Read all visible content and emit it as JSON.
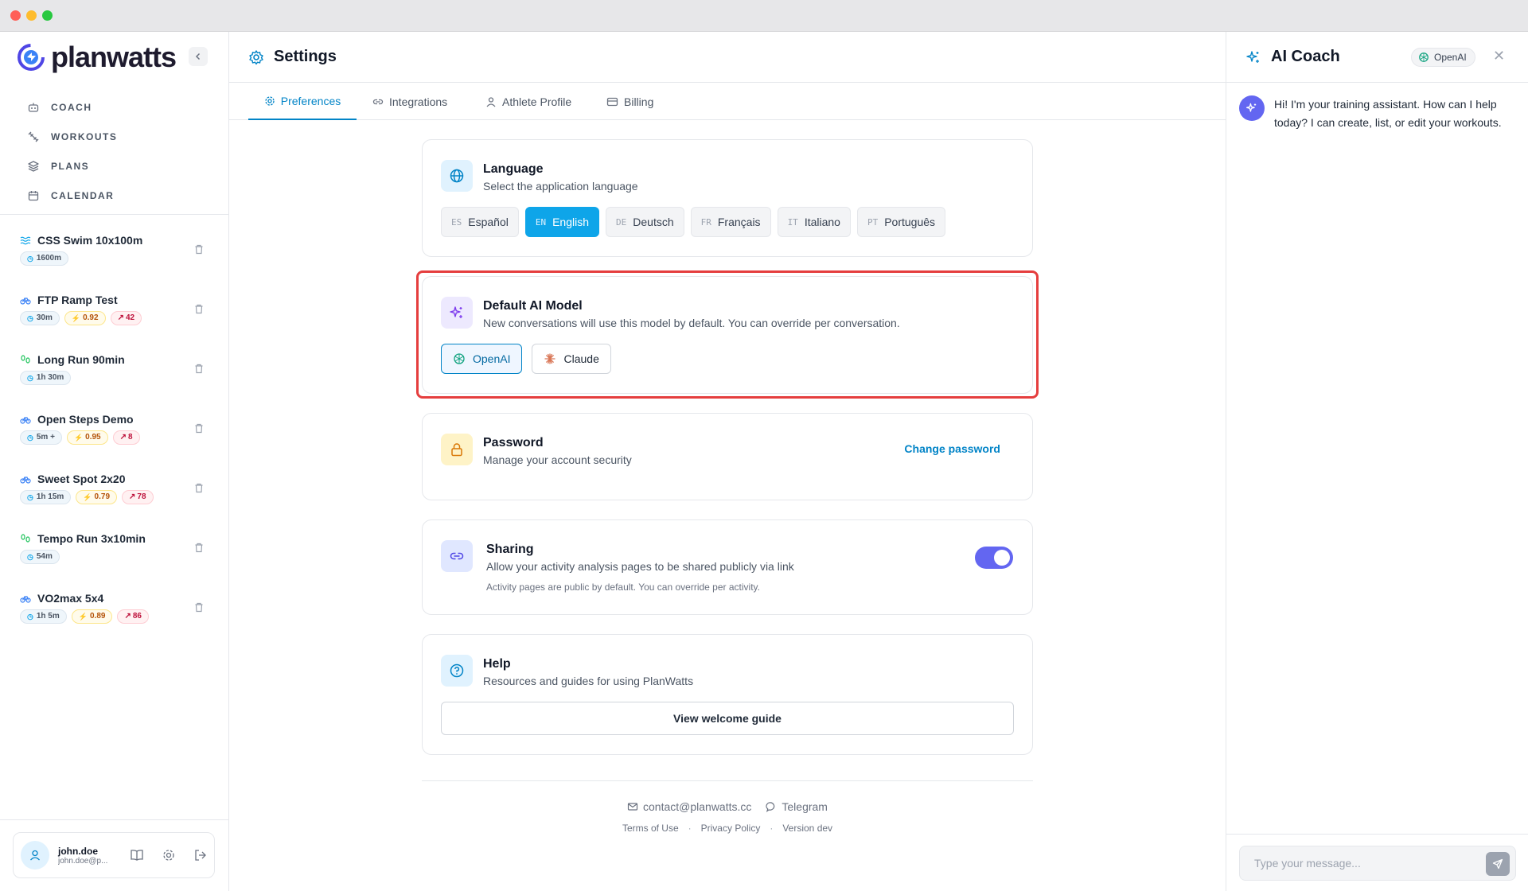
{
  "sidebar": {
    "brand": "planwatts",
    "nav": [
      {
        "label": "COACH",
        "icon": "robot-icon"
      },
      {
        "label": "WORKOUTS",
        "icon": "dumbbell-icon"
      },
      {
        "label": "PLANS",
        "icon": "layers-icon"
      },
      {
        "label": "CALENDAR",
        "icon": "calendar-icon"
      }
    ],
    "workouts": [
      {
        "name": "CSS Swim 10x100m",
        "sport": "swim",
        "time": "1600m",
        "if": "",
        "tss": ""
      },
      {
        "name": "FTP Ramp Test",
        "sport": "bike",
        "time": "30m",
        "if": "0.92",
        "tss": "42"
      },
      {
        "name": "Long Run 90min",
        "sport": "run",
        "time": "1h 30m",
        "if": "",
        "tss": ""
      },
      {
        "name": "Open Steps Demo",
        "sport": "bike",
        "time": "5m +",
        "if": "0.95",
        "tss": "8"
      },
      {
        "name": "Sweet Spot 2x20",
        "sport": "bike",
        "time": "1h 15m",
        "if": "0.79",
        "tss": "78"
      },
      {
        "name": "Tempo Run 3x10min",
        "sport": "run",
        "time": "54m",
        "if": "",
        "tss": ""
      },
      {
        "name": "VO2max 5x4",
        "sport": "bike",
        "time": "1h 5m",
        "if": "0.89",
        "tss": "86"
      }
    ],
    "user": {
      "name": "john.doe",
      "email": "john.doe@p..."
    }
  },
  "main": {
    "title": "Settings",
    "tabs": [
      "Preferences",
      "Integrations",
      "Athlete Profile",
      "Billing"
    ],
    "language": {
      "title": "Language",
      "subtitle": "Select the application language",
      "options": [
        {
          "code": "ES",
          "label": "Español"
        },
        {
          "code": "EN",
          "label": "English",
          "selected": true
        },
        {
          "code": "DE",
          "label": "Deutsch"
        },
        {
          "code": "FR",
          "label": "Français"
        },
        {
          "code": "IT",
          "label": "Italiano"
        },
        {
          "code": "PT",
          "label": "Português"
        }
      ]
    },
    "ai_model": {
      "title": "Default AI Model",
      "subtitle": "New conversations will use this model by default. You can override per conversation.",
      "options": [
        {
          "label": "OpenAI",
          "selected": true
        },
        {
          "label": "Claude"
        }
      ]
    },
    "password": {
      "title": "Password",
      "subtitle": "Manage your account security",
      "action": "Change password"
    },
    "sharing": {
      "title": "Sharing",
      "subtitle": "Allow your activity analysis pages to be shared publicly via link",
      "note": "Activity pages are public by default. You can override per activity.",
      "enabled": true
    },
    "help": {
      "title": "Help",
      "subtitle": "Resources and guides for using PlanWatts",
      "action": "View welcome guide"
    },
    "footer": {
      "email": "contact@planwatts.cc",
      "telegram": "Telegram",
      "terms": "Terms of Use",
      "privacy": "Privacy Policy",
      "version": "Version dev"
    }
  },
  "coach": {
    "title": "AI Coach",
    "model": "OpenAI",
    "message": "Hi! I'm your training assistant. How can I help today? I can create, list, or edit your workouts.",
    "input_placeholder": "Type your message..."
  },
  "colors": {
    "accent": "#0284c7",
    "language_selected": "#0ea5e9",
    "toggle_on": "#6366f1",
    "highlight": "#e53e3e"
  }
}
